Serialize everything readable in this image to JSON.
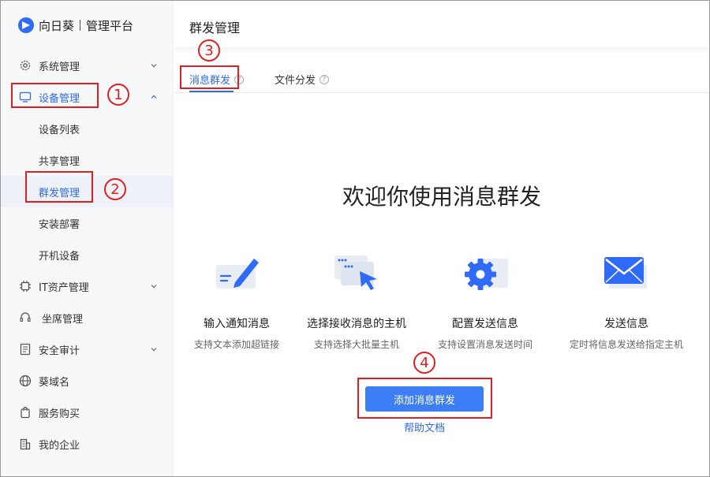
{
  "brand": {
    "name": "向日葵",
    "sub": "管理平台"
  },
  "sidebar": {
    "items": [
      {
        "label": "系统管理"
      },
      {
        "label": "设备管理"
      },
      {
        "label": "IT资产管理"
      },
      {
        "label": "坐席管理"
      },
      {
        "label": "安全审计"
      },
      {
        "label": "葵域名"
      },
      {
        "label": "服务购买"
      },
      {
        "label": "我的企业"
      }
    ],
    "device_sub": [
      {
        "label": "设备列表"
      },
      {
        "label": "共享管理"
      },
      {
        "label": "群发管理"
      },
      {
        "label": "安装部署"
      },
      {
        "label": "开机设备"
      }
    ]
  },
  "annotations": {
    "n1": "1",
    "n2": "2",
    "n3": "3",
    "n4": "4"
  },
  "main": {
    "title": "群发管理",
    "tabs": [
      {
        "label": "消息群发"
      },
      {
        "label": "文件分发"
      }
    ],
    "welcome": "欢迎你使用消息群发",
    "features": [
      {
        "title": "输入通知消息",
        "desc": "支持文本添加超链接",
        "icon": "edit-message-icon"
      },
      {
        "title": "选择接收消息的主机",
        "desc": "支持选择大批量主机",
        "icon": "select-host-icon"
      },
      {
        "title": "配置发送信息",
        "desc": "支持设置消息发送时间",
        "icon": "settings-gear-icon"
      },
      {
        "title": "发送信息",
        "desc": "定时将信息发送给指定主机",
        "icon": "envelope-icon"
      }
    ],
    "add_button": "添加消息群发",
    "help_link": "帮助文档"
  },
  "colors": {
    "accent": "#2f6bf6",
    "annotation": "#e02020",
    "button": "#3d7df6"
  }
}
